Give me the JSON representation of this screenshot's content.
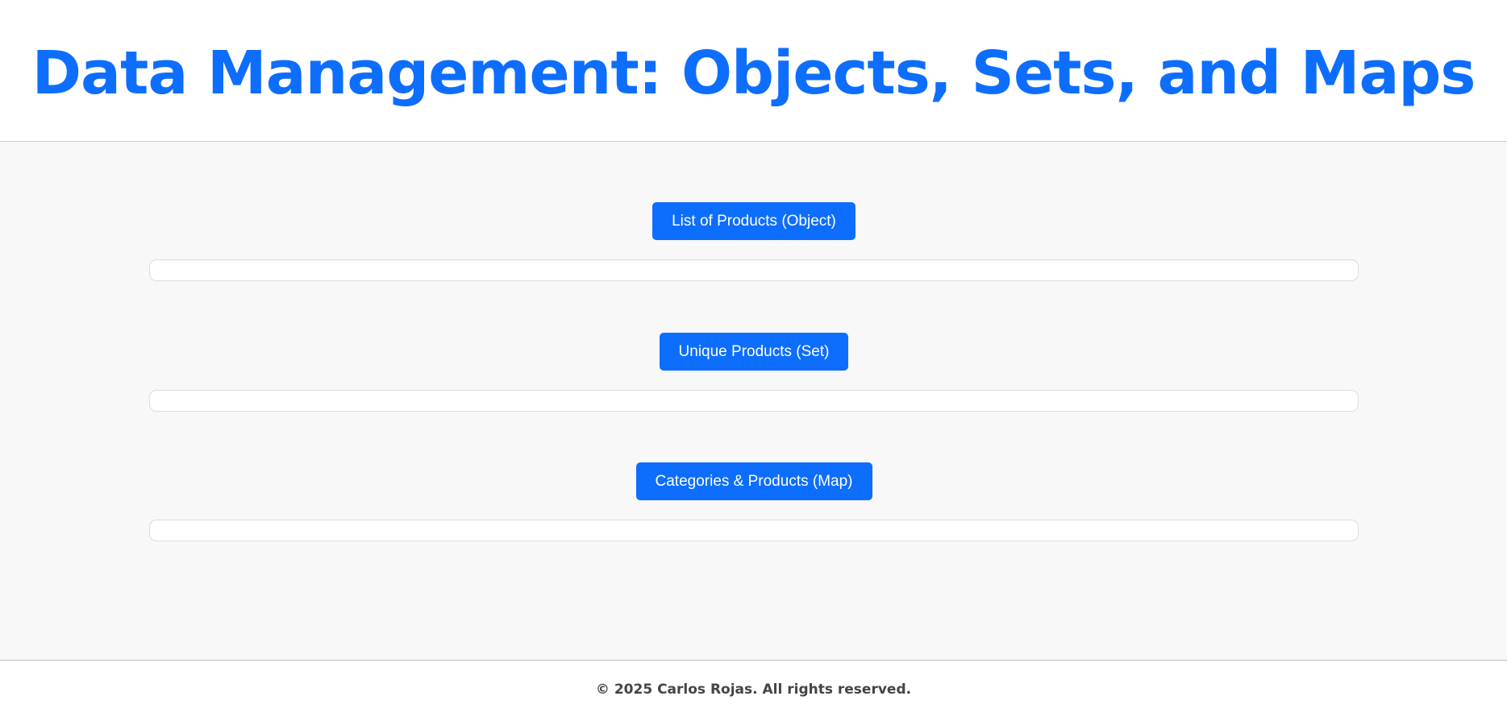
{
  "header": {
    "title": "Data Management: Objects, Sets, and Maps"
  },
  "main": {
    "sections": [
      {
        "button_label": "List of Products (Object)",
        "output_text": ""
      },
      {
        "button_label": "Unique Products (Set)",
        "output_text": ""
      },
      {
        "button_label": "Categories & Products (Map)",
        "output_text": ""
      }
    ]
  },
  "footer": {
    "text": "© 2025 Carlos Rojas. All rights reserved."
  },
  "colors": {
    "accent": "#0d6efd",
    "background": "#f8f8f8"
  }
}
